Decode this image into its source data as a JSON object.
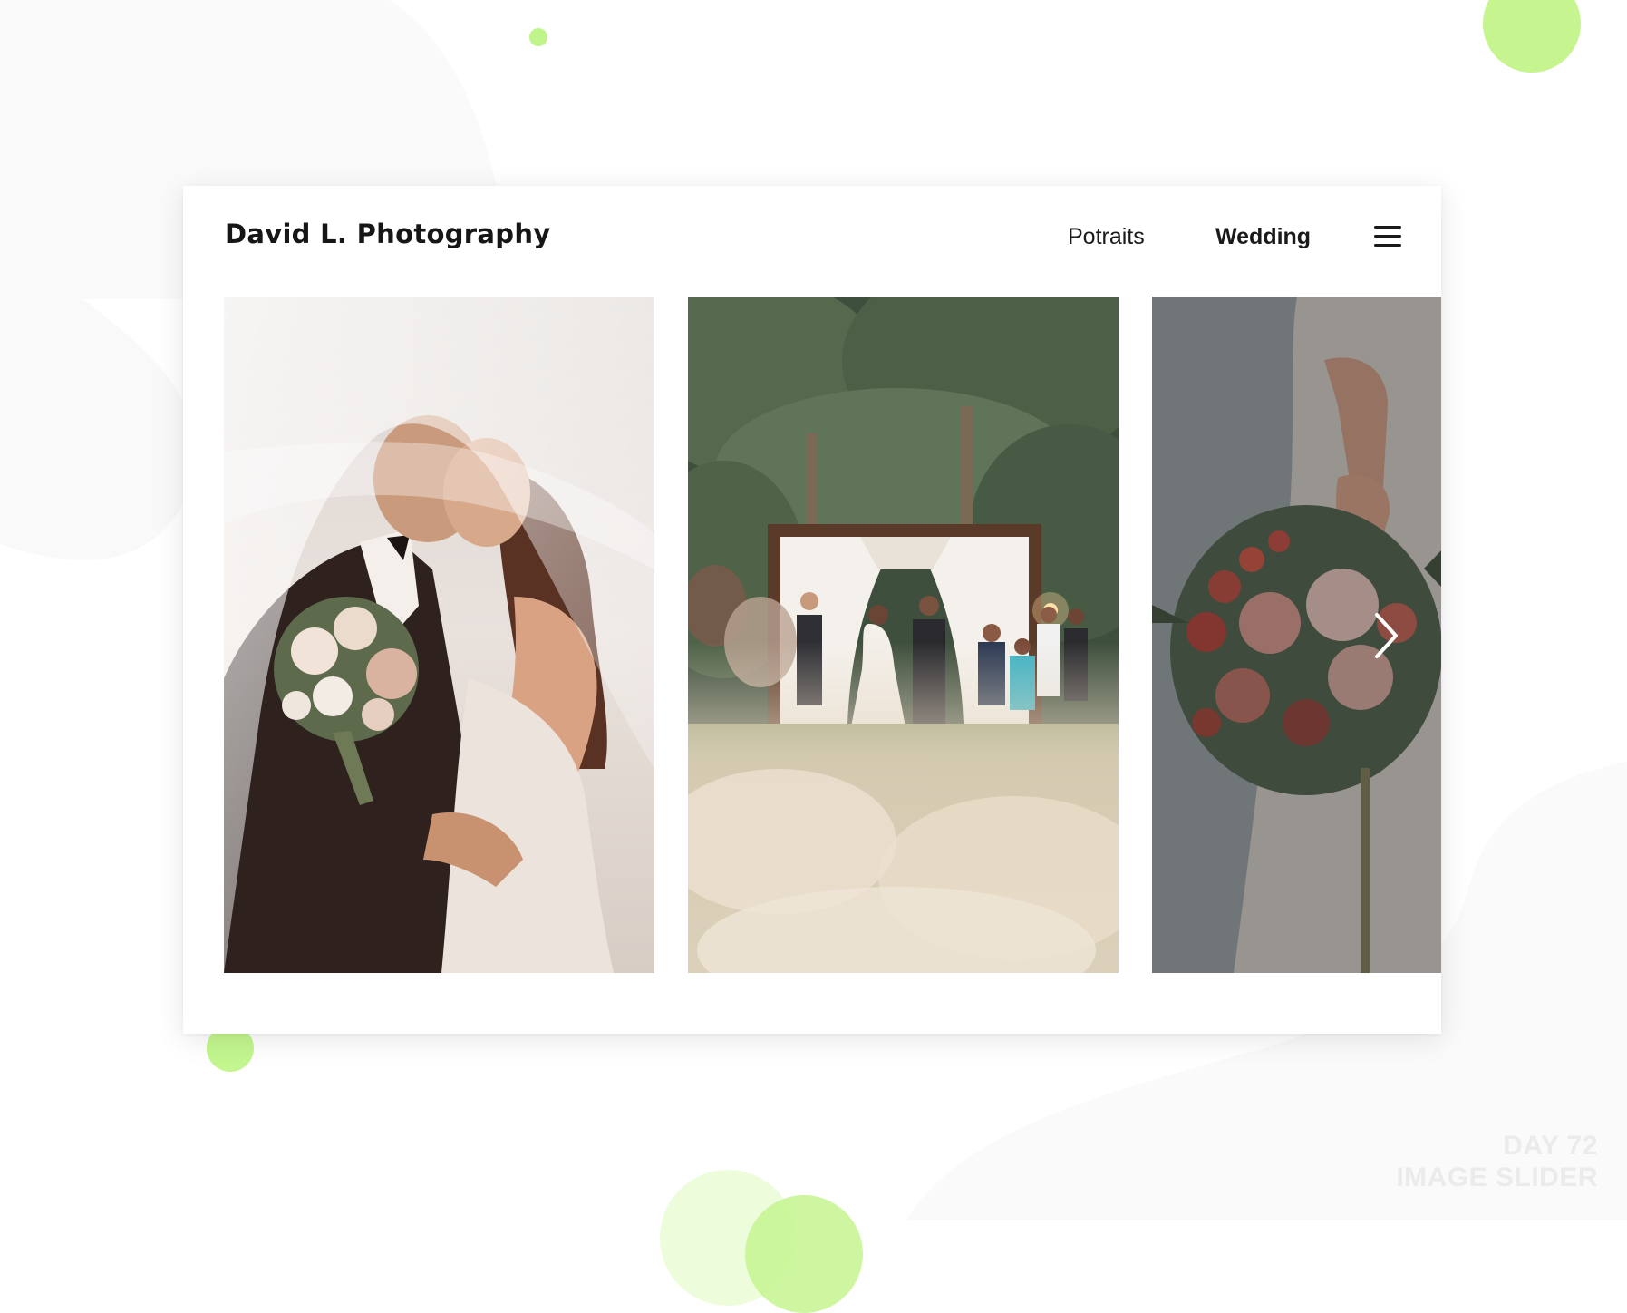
{
  "app": {
    "brand": "David L. Photography"
  },
  "nav": {
    "items": [
      {
        "label": "Potraits",
        "active": false
      },
      {
        "label": "Wedding",
        "active": true
      }
    ],
    "menu_icon": "hamburger-menu-icon"
  },
  "slider": {
    "slides": [
      {
        "subject": "bride and groom kissing under veil holding bouquet"
      },
      {
        "subject": "outdoor wedding ceremony under palm trees"
      },
      {
        "subject": "bride's hand holding red and pink floral bouquet"
      }
    ],
    "next_icon": "chevron-right-icon"
  },
  "watermark": {
    "line1": "DAY 72",
    "line2": "IMAGE SLIDER"
  },
  "colors": {
    "accent_green": "#bff58a",
    "text_dark": "#161616",
    "watermark_gray": "#ebebeb"
  }
}
